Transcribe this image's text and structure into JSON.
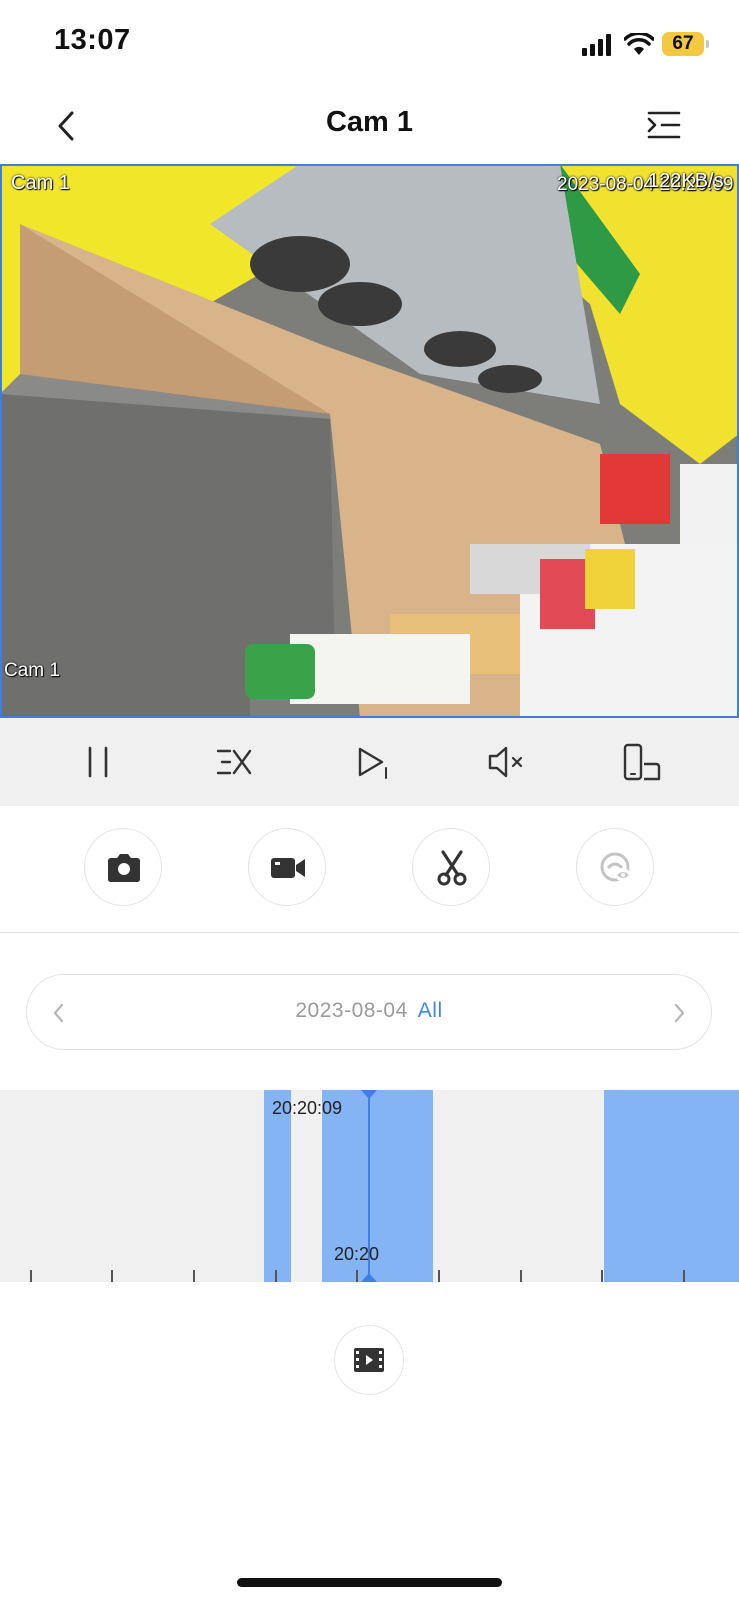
{
  "status_bar": {
    "time": "13:07",
    "battery": "67"
  },
  "nav": {
    "title": "Cam 1"
  },
  "video": {
    "channel_label_top": "Cam 1",
    "channel_label_bottom": "Cam 1",
    "timestamp": "2023-08-04 20:20:09",
    "bitrate": "122KB/s"
  },
  "toolbar": {
    "icons": [
      "pause-icon",
      "speed-icon",
      "play-frame-icon",
      "mute-icon",
      "rotate-screen-icon"
    ]
  },
  "actions": {
    "icons": [
      "camera-icon",
      "record-icon",
      "scissors-icon",
      "privacy-eye-icon"
    ]
  },
  "date_selector": {
    "date": "2023-08-04",
    "filter": "All"
  },
  "timeline": {
    "current_time": "20:20:09",
    "hour_label": "20:20",
    "colors": {
      "recording": "#85b4f5",
      "playhead": "#3f80e8",
      "background": "#f0f0f0"
    }
  }
}
